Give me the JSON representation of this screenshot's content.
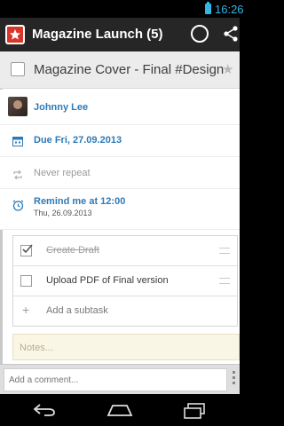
{
  "status_bar": {
    "time": "16:26"
  },
  "action_bar": {
    "title": "Magazine Launch (5)"
  },
  "task": {
    "title": "Magazine Cover - Final #Design",
    "assignee": "Johnny  Lee",
    "due": "Due Fri, 27.09.2013",
    "repeat": "Never repeat",
    "reminder": "Remind me at 12:00",
    "reminder_date": "Thu, 26.09.2013"
  },
  "subtasks": [
    {
      "label": "Create Draft",
      "done": true
    },
    {
      "label": "Upload PDF of Final version",
      "done": false
    }
  ],
  "add_subtask_label": "Add a subtask",
  "notes_placeholder": "Notes...",
  "comment_placeholder": "Add a comment...",
  "colors": {
    "accent": "#2e7ab7",
    "status": "#33b5e5",
    "logo": "#d9362b"
  },
  "icons": [
    "wunderlist-logo-icon",
    "sync-ring-icon",
    "share-icon",
    "star-icon",
    "calendar-icon",
    "repeat-icon",
    "alarm-icon",
    "checkmark-icon",
    "drag-handle-icon",
    "plus-icon",
    "overflow-icon",
    "back-icon",
    "home-icon",
    "recents-icon"
  ]
}
